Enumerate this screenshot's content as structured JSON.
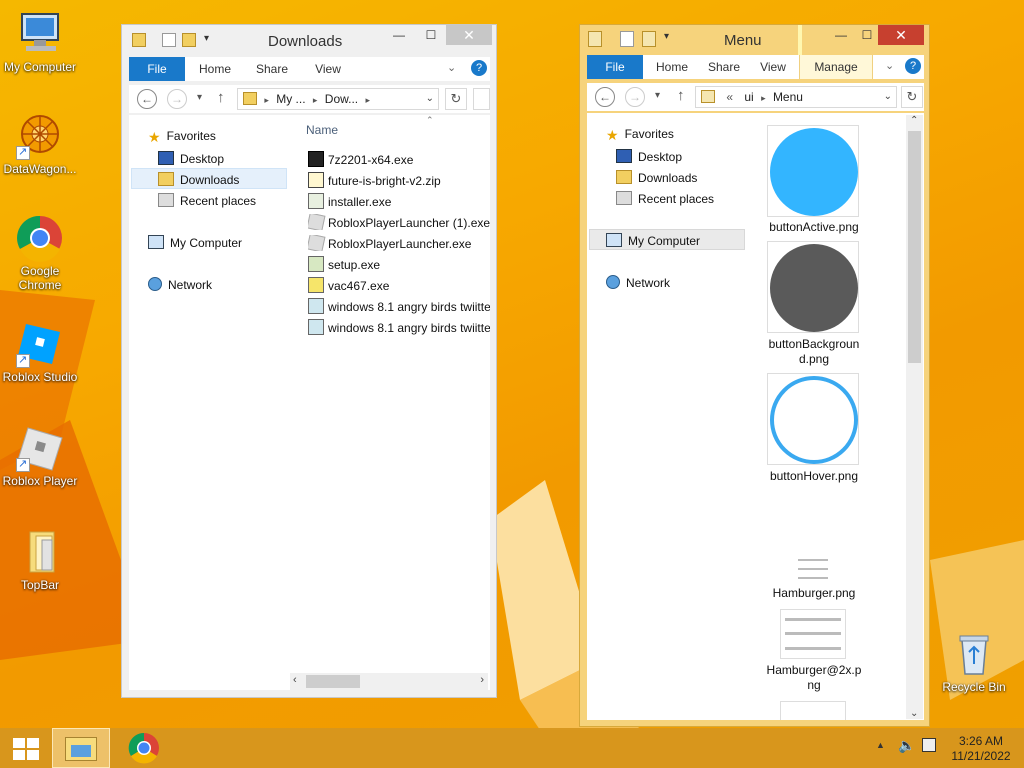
{
  "desktop": {
    "icons": [
      {
        "label": "My Computer",
        "icon": "computer-icon"
      },
      {
        "label": "DataWagon...",
        "icon": "datawagon-icon"
      },
      {
        "label": "Google Chrome",
        "icon": "chrome-icon"
      },
      {
        "label": "Roblox Studio",
        "icon": "roblox-studio-icon"
      },
      {
        "label": "Roblox Player",
        "icon": "roblox-player-icon"
      },
      {
        "label": "TopBar",
        "icon": "folder-icon"
      },
      {
        "label": "Recycle Bin",
        "icon": "recycle-bin-icon"
      }
    ]
  },
  "downloads_window": {
    "title": "Downloads",
    "tabs": [
      "File",
      "Home",
      "Share",
      "View"
    ],
    "address": [
      "My ...",
      "Dow..."
    ],
    "nav": {
      "favorites": "Favorites",
      "desktop": "Desktop",
      "downloads": "Downloads",
      "recent": "Recent places",
      "computer": "My Computer",
      "network": "Network"
    },
    "column_header": "Name",
    "files": [
      "7z2201-x64.exe",
      "future-is-bright-v2.zip",
      "installer.exe",
      "RobloxPlayerLauncher (1).exe",
      "RobloxPlayerLauncher.exe",
      "setup.exe",
      "vac467.exe",
      "windows 8.1 angry birds twiitte",
      "windows 8.1 angry birds twiitte"
    ]
  },
  "menu_window": {
    "title": "Menu",
    "tabs": [
      "File",
      "Home",
      "Share",
      "View",
      "Manage"
    ],
    "address": [
      "«",
      "ui",
      "Menu"
    ],
    "nav": {
      "favorites": "Favorites",
      "desktop": "Desktop",
      "downloads": "Downloads",
      "recent": "Recent places",
      "computer": "My Computer",
      "network": "Network"
    },
    "thumbs": [
      {
        "label1": "buttonActive.png",
        "label2": ""
      },
      {
        "label1": "buttonBackgroun",
        "label2": "d.png"
      },
      {
        "label1": "buttonHover.png",
        "label2": ""
      },
      {
        "label1": "Hamburger.png",
        "label2": ""
      },
      {
        "label1": "Hamburger@2x.p",
        "label2": "ng"
      }
    ],
    "colors": {
      "active": "#33b5ff",
      "background": "#5a5a5a",
      "hover": "#3aa9f0"
    }
  },
  "taskbar": {
    "time": "3:26 AM",
    "date": "11/21/2022"
  }
}
